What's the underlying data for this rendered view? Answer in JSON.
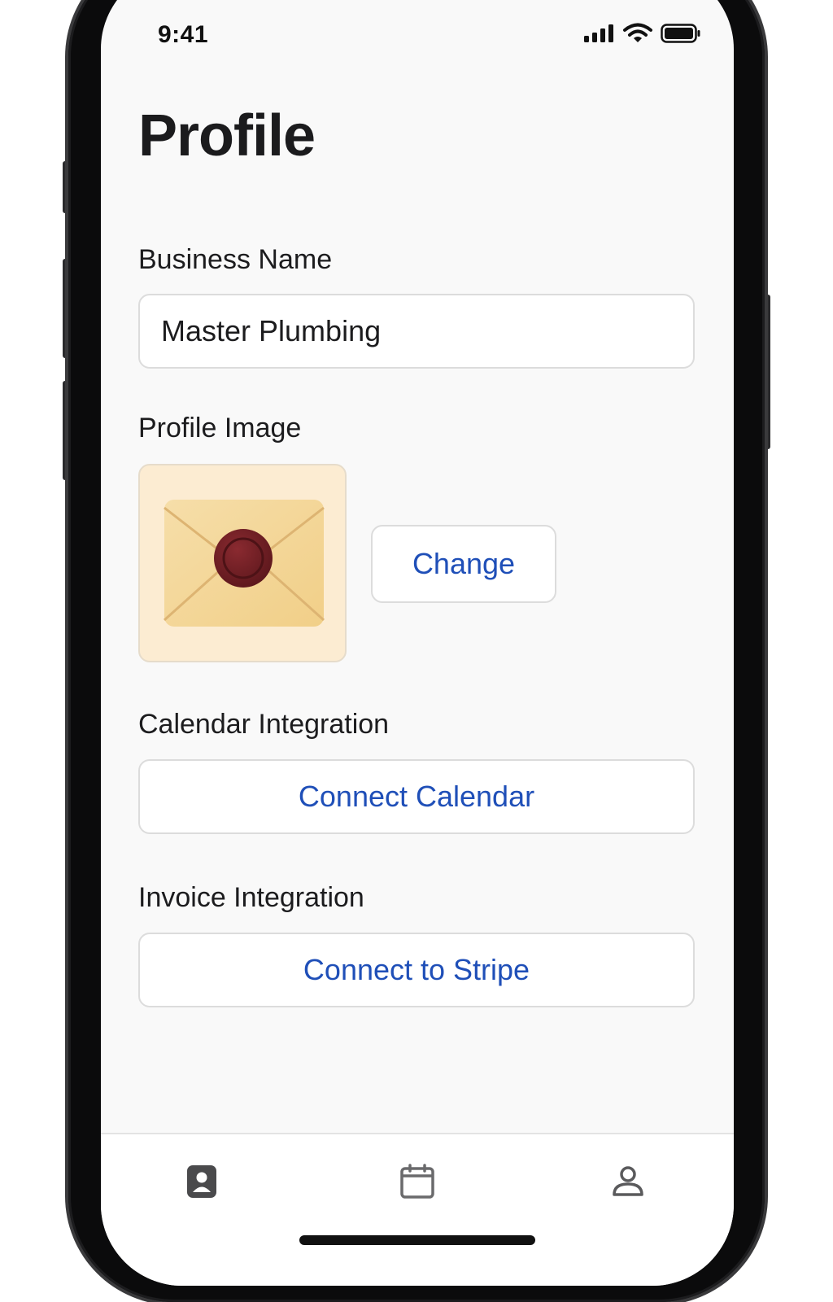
{
  "status_bar": {
    "time": "9:41",
    "icons": [
      "cellular-signal-icon",
      "wifi-icon",
      "battery-icon"
    ]
  },
  "page": {
    "title": "Profile"
  },
  "business_name": {
    "label": "Business Name",
    "value": "Master Plumbing"
  },
  "profile_image": {
    "label": "Profile Image",
    "image": "sealed-envelope-image",
    "change_label": "Change"
  },
  "calendar": {
    "label": "Calendar Integration",
    "button_label": "Connect Calendar"
  },
  "invoice": {
    "label": "Invoice Integration",
    "button_label": "Connect to Stripe"
  },
  "tab_bar": {
    "items": [
      {
        "icon": "profile-card-icon"
      },
      {
        "icon": "calendar-icon"
      },
      {
        "icon": "person-icon"
      }
    ]
  },
  "colors": {
    "accent": "#1f4fb8",
    "background": "#f9f9f9",
    "border": "#dcdcdc",
    "avatar_bg": "#fcecd2",
    "wax_seal": "#6e1f24"
  }
}
